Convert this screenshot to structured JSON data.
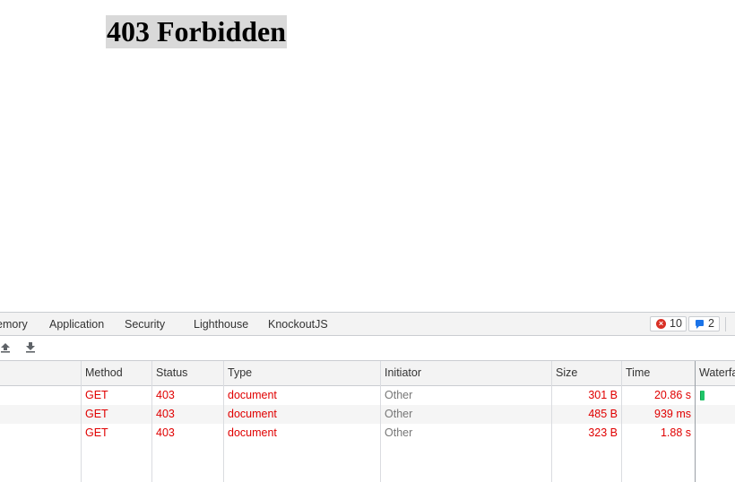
{
  "page": {
    "heading": "403 Forbidden"
  },
  "devtools": {
    "tabs": [
      "emory",
      "Application",
      "Security",
      "Lighthouse",
      "KnockoutJS"
    ],
    "errors_count": "10",
    "messages_count": "2",
    "toolbar_icons": [
      "upload-har-icon",
      "download-har-icon"
    ],
    "columns": [
      "Method",
      "Status",
      "Type",
      "Initiator",
      "Size",
      "Time",
      "Waterfa"
    ],
    "rows": [
      {
        "method": "GET",
        "status": "403",
        "type": "document",
        "initiator": "Other",
        "size": "301 B",
        "time": "20.86 s"
      },
      {
        "method": "GET",
        "status": "403",
        "type": "document",
        "initiator": "Other",
        "size": "485 B",
        "time": "939 ms"
      },
      {
        "method": "GET",
        "status": "403",
        "type": "document",
        "initiator": "Other",
        "size": "323 B",
        "time": "1.88 s"
      }
    ],
    "colors": {
      "error_text": "#e00000",
      "waterfall_bar": "#1fc468",
      "error_badge": "#d93025",
      "message_badge": "#1a73e8"
    }
  }
}
